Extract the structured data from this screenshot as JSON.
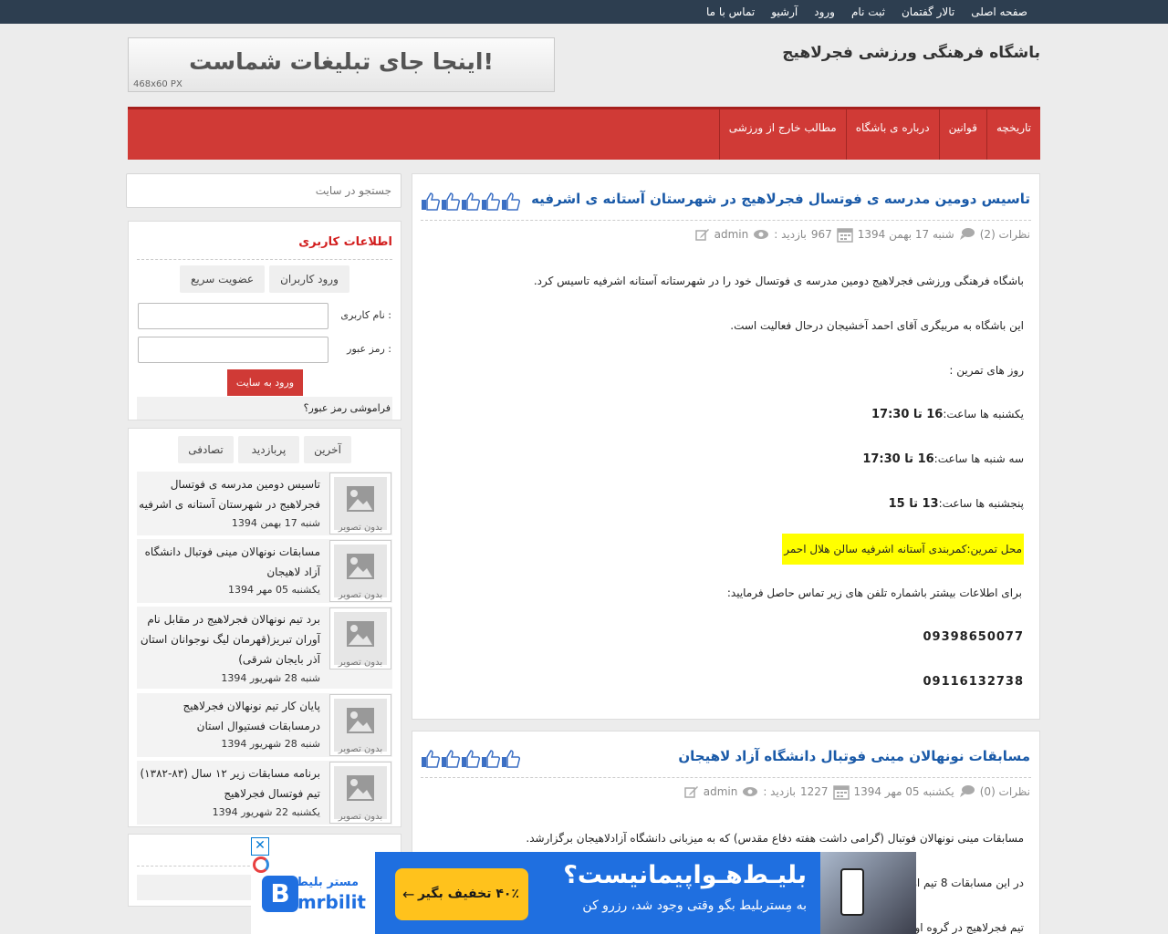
{
  "topnav": [
    "صفحه اصلی",
    "تالار گفتمان",
    "ثبت نام",
    "ورود",
    "آرشیو",
    "تماس با ما"
  ],
  "site_title": "باشگاه فرهنگی ورزشی فجرلاهیج",
  "header_ad": {
    "text": "اینجا جای تبلیغات شماست!",
    "size": "468x60   PX"
  },
  "mainnav": [
    "تاریخچه",
    "قوانین",
    "درباره ی باشگاه",
    "مطالب خارج از ورزشی"
  ],
  "search": {
    "placeholder": "جستجو در سایت"
  },
  "login_widget": {
    "title": "اطلاعات کاربری",
    "tab_login": "ورود کاربران",
    "tab_register": "عضویت سریع",
    "username_label": "نام کاربری :",
    "password_label": "رمز عبور :",
    "submit": "ورود به سایت",
    "forgot": "فراموشی رمز عبور؟"
  },
  "recent_widget": {
    "tabs": [
      "آخرین",
      "پربازدید",
      "تصادفی"
    ],
    "thumb_caption": "بدون تصویر",
    "items": [
      {
        "title": "تاسیس دومین مدرسه ی فوتسال فجرلاهیج در شهرستان آستانه ی اشرفیه",
        "date": "شنبه 17 بهمن 1394"
      },
      {
        "title": "مسابقات نونهالان مینی فوتبال دانشگاه آزاد لاهیجان",
        "date": "یکشنبه 05 مهر 1394"
      },
      {
        "title": "برد تیم نونهالان فجرلاهیج در مقابل نام آوران تبریز(قهرمان لیگ نوجوانان استان آذر بایجان شرقی)",
        "date": "شنبه 28 شهریور 1394"
      },
      {
        "title": "پایان کار تیم نونهالان فجرلاهیج درمسابقات فستیوال استان",
        "date": "شنبه 28 شهریور 1394"
      },
      {
        "title": "برنامه مسابقات زیر ۱۲ سال (۸۳-۱۳۸۲) تیم فوتسال فجرلاهیج",
        "date": "یکشنبه 22 شهریور 1394"
      }
    ]
  },
  "posts": [
    {
      "title": "تاسیس دومین مدرسه ی فوتسال فجرلاهیج در شهرستان آستانه ی اشرفیه",
      "author": "admin",
      "views_label": "بازدید :",
      "views": "967",
      "date": "شنبه 17 بهمن 1394",
      "comments": "نظرات (2)",
      "body": {
        "p1": "باشگاه فرهنگی ورزشی فجرلاهیج دومین مدرسه ی فوتسال خود را در شهرستانه آستانه اشرفیه تاسیس کرد.",
        "p2": "این باشگاه  به مربیگری آقای احمد آخشیجان درحال فعالیت است.",
        "p3": "روز های تمرین :",
        "day1": "یکشنبه ها     ساعت:",
        "day1_time": "16 تا 17:30",
        "day2": "سه شنبه ها    ساعت:",
        "day2_time": "16 تا 17:30",
        "day3": "پنجشنبه ها     ساعت:",
        "day3_time": "13 تا 15",
        "location": "محل تمرین:کمربندی آستانه اشرفیه سالن هلال احمر",
        "contact": "برای اطلاعات بیشتر باشماره تلفن های زیر تماس حاصل فرمایید:",
        "phone1": "09398650077",
        "phone2": "09116132738"
      }
    },
    {
      "title": "مسابقات نونهالان مینی فوتبال دانشگاه آزاد لاهیجان",
      "author": "admin",
      "views_label": "بازدید :",
      "views": "1227",
      "date": "یکشنبه 05 مهر 1394",
      "comments": "نظرات (0)",
      "body": {
        "p1": "مسابقات مینی نونهالان فوتبال (گرامی داشت هفته دفاع مقدس) که به میزبانی دانشگاه آزادلاهیجان برگزارشد.",
        "p2": "در این مسابقات 8 تیم از",
        "p3": "تیم فجرلاهیج در گروه او"
      }
    }
  ],
  "floating_ad": {
    "brand_fa": "مستر بلیط",
    "brand_en": "mrbilit",
    "headline": "بلیـط‌هـواپیمانیست؟",
    "subline": "به مِستربلیط بگو وقتی وجود شد، رزرو کن",
    "cta": "۴۰٪ تخفیف بگیر",
    "close": "✕"
  },
  "colors": {
    "topbar": "#2d3e50",
    "nav_red": "#d03a36",
    "link_blue": "#1a5aa8",
    "highlight": "#ffff00",
    "ad_blue": "#1f6fe0",
    "ad_cta": "#ffc21c"
  },
  "icons": [
    "edit-icon",
    "eye-icon",
    "calendar-icon",
    "comment-icon",
    "thumbs-up-icon",
    "image-placeholder-icon",
    "close-icon",
    "arrow-left-icon"
  ]
}
